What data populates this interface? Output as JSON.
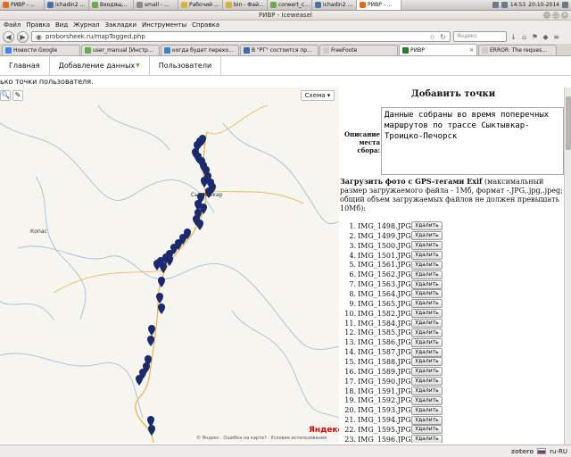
{
  "taskbar": {
    "items": [
      {
        "label": "РИВР - ...",
        "color": "#e06a1b",
        "active": false
      },
      {
        "label": "ichadin2 ...",
        "color": "#4a6fa5",
        "active": false
      },
      {
        "label": "Входящ...",
        "color": "#6aa84f",
        "active": false
      },
      {
        "label": "small - ...",
        "color": "#8a8a8a",
        "active": false
      },
      {
        "label": "Рабочий ...",
        "color": "#d8b13a",
        "active": false
      },
      {
        "label": "bin - Фай...",
        "color": "#d8b13a",
        "active": false
      },
      {
        "label": "corwert_c...",
        "color": "#6aa84f",
        "active": false
      },
      {
        "label": "ichadin2 ...",
        "color": "#4a6fa5",
        "active": false
      },
      {
        "label": "РИВР - ...",
        "color": "#e06a1b",
        "active": true
      }
    ],
    "time": "14:53",
    "date": "20-10-2014"
  },
  "window": {
    "title": "РИВР - Iceweasel"
  },
  "menu": [
    "Файл",
    "Правка",
    "Вид",
    "Журнал",
    "Закладки",
    "Инструменты",
    "Справка"
  ],
  "nav": {
    "url": "proborsheek.ru/mapTogged.php",
    "search_placeholder": "Яндекс"
  },
  "tabs": [
    {
      "label": "Новости Google",
      "color": "#4285f4",
      "active": false
    },
    {
      "label": "user_manual [Инстр...",
      "color": "#6aa84f",
      "active": false
    },
    {
      "label": "когда будет перехо...",
      "color": "#3b82c4",
      "active": false
    },
    {
      "label": "В \"РГ\" состоится пр...",
      "color": "#3b6ab0",
      "active": false
    },
    {
      "label": "FreeFoote",
      "color": "#cccccc",
      "active": false
    },
    {
      "label": "РИВР",
      "color": "#2c7a2c",
      "active": true
    },
    {
      "label": "ERROR: The reques...",
      "color": "#cccccc",
      "active": false
    }
  ],
  "site_nav": [
    {
      "label": "Главная",
      "dropdown": false
    },
    {
      "label": "Добавление данных",
      "dropdown": true
    },
    {
      "label": "Пользователи",
      "dropdown": false
    }
  ],
  "intro_text": "ько точки пользователя.",
  "map": {
    "schema_button": "Схема ▾",
    "labels": {
      "city": "Сыктывкар",
      "town": "Копас"
    },
    "yandex_logo": "Яндекс",
    "footer": "© Яндекс · Ошибка на карте? · Условия использования",
    "marker_color": "#1a2a6c"
  },
  "panel": {
    "title": "Добавить точки",
    "desc_label": "Описание места сбора:",
    "desc_value": "Данные собраны во время поперечных маршрутов по трассе Сыктывкар-Троицко-Печорск",
    "upload_bold": "Загрузить фото с GPS-тегами Exif",
    "upload_rest": " (максимальный размер загружаемого файла - 1Мб, формат -.JPG,.jpg,.jpeg; общий объем загружаемых файлов не должен превышать 10Мб):",
    "delete_label": "Удалить",
    "files": [
      "IMG_1498.JPG",
      "IMG_1499.JPG",
      "IMG_1500.JPG",
      "IMG_1501.JPG",
      "IMG_1561.JPG",
      "IMG_1562.JPG",
      "IMG_1563.JPG",
      "IMG_1564.JPG",
      "IMG_1565.JPG",
      "IMG_1582.JPG",
      "IMG_1584.JPG",
      "IMG_1585.JPG",
      "IMG_1586.JPG",
      "IMG_1587.JPG",
      "IMG_1588.JPG",
      "IMG_1589.JPG",
      "IMG_1590.JPG",
      "IMG_1591.JPG",
      "IMG_1592.JPG",
      "IMG_1593.JPG",
      "IMG_1594.JPG",
      "IMG_1595.JPG",
      "IMG_1596.JPG"
    ]
  },
  "status": {
    "zotero": "zotero",
    "lang": "ru-RU"
  }
}
